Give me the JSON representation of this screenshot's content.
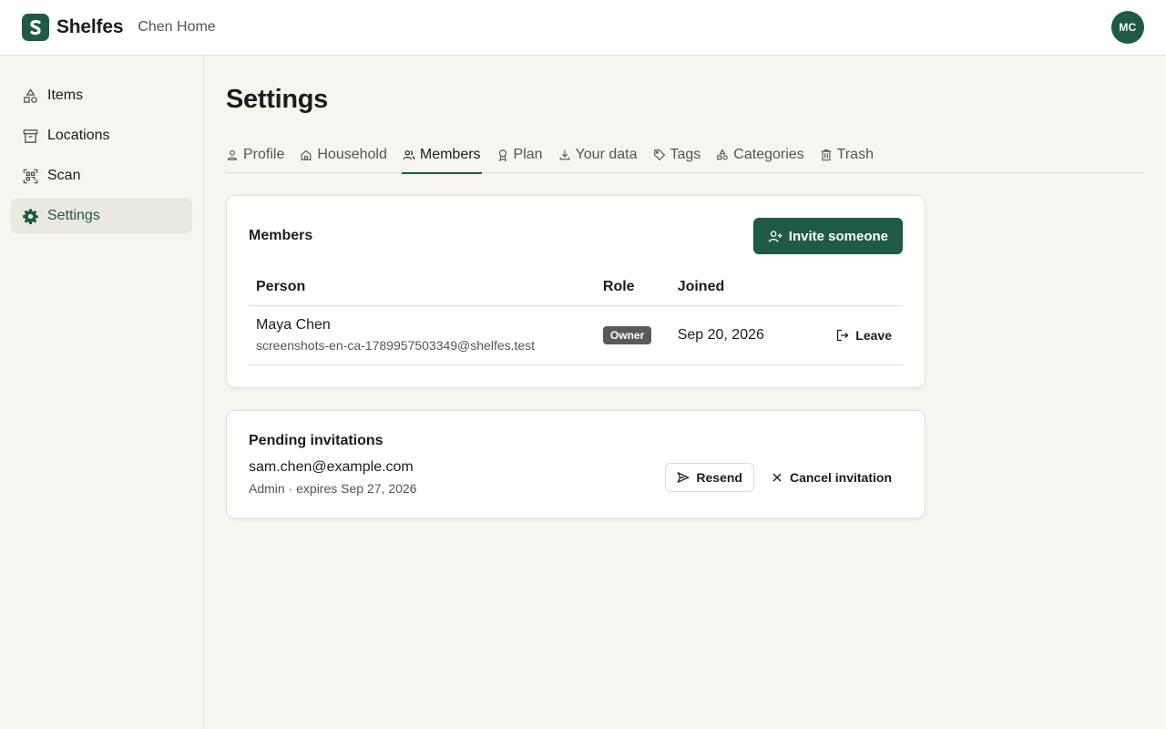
{
  "header": {
    "logo_letter": "S",
    "brand": "Shelfes",
    "household": "Chen Home",
    "avatar_initials": "MC"
  },
  "sidebar": {
    "items": [
      {
        "label": "Items",
        "icon": "shapes-icon"
      },
      {
        "label": "Locations",
        "icon": "archive-box-icon"
      },
      {
        "label": "Scan",
        "icon": "qr-scan-icon"
      },
      {
        "label": "Settings",
        "icon": "gear-icon",
        "active": true
      }
    ]
  },
  "page": {
    "title": "Settings"
  },
  "tabs": [
    {
      "label": "Profile",
      "icon": "user-icon"
    },
    {
      "label": "Household",
      "icon": "home-icon"
    },
    {
      "label": "Members",
      "icon": "users-icon",
      "active": true
    },
    {
      "label": "Plan",
      "icon": "award-icon"
    },
    {
      "label": "Your data",
      "icon": "download-icon"
    },
    {
      "label": "Tags",
      "icon": "tag-icon"
    },
    {
      "label": "Categories",
      "icon": "shapes-icon"
    },
    {
      "label": "Trash",
      "icon": "trash-icon"
    }
  ],
  "members": {
    "title": "Members",
    "invite_label": "Invite someone",
    "columns": [
      "Person",
      "Role",
      "Joined"
    ],
    "rows": [
      {
        "name": "Maya Chen",
        "email": "screenshots-en-ca-1789957503349@shelfes.test",
        "role": "Owner",
        "joined": "Sep 20, 2026",
        "action": "Leave"
      }
    ]
  },
  "pending": {
    "title": "Pending invitations",
    "items": [
      {
        "email": "sam.chen@example.com",
        "meta": "Admin · expires Sep 27, 2026",
        "resend_label": "Resend",
        "cancel_label": "Cancel invitation"
      }
    ]
  },
  "colors": {
    "brand": "#1f5a47",
    "background": "#f6f5f0",
    "badge": "#5a5a56"
  }
}
